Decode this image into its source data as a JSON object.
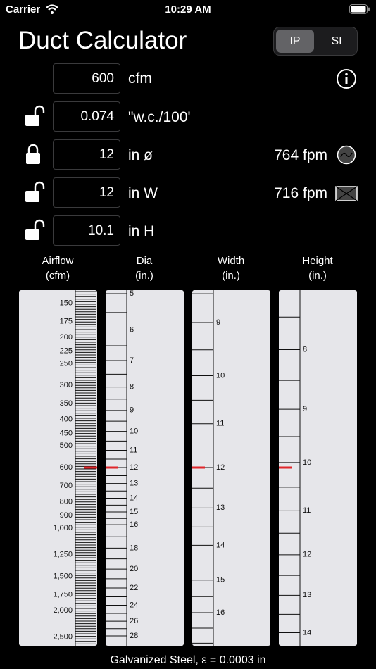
{
  "status": {
    "carrier": "Carrier",
    "time": "10:29 AM"
  },
  "title": "Duct Calculator",
  "units_toggle": {
    "options": [
      "IP",
      "SI"
    ],
    "selected": "IP"
  },
  "fields": [
    {
      "value": "600",
      "unit": "cfm",
      "locked": null
    },
    {
      "value": "0.074",
      "unit": "\"w.c./100'",
      "locked": false
    },
    {
      "value": "12",
      "unit": "in ø",
      "locked": true
    },
    {
      "value": "12",
      "unit": "in W",
      "locked": false
    },
    {
      "value": "10.1",
      "unit": "in H",
      "locked": false
    }
  ],
  "velocities": {
    "round": "764 fpm",
    "rect": "716 fpm"
  },
  "icons": {
    "info": "info-icon",
    "round": "round-duct-icon",
    "rect": "rect-duct-icon",
    "lock": "lock-icon",
    "unlock": "unlock-icon",
    "wifi": "wifi-icon",
    "battery": "battery-icon"
  },
  "columns": [
    {
      "line1": "Airflow",
      "line2": "(cfm)"
    },
    {
      "line1": "Dia",
      "line2": "(in.)"
    },
    {
      "line1": "Width",
      "line2": "(in.)"
    },
    {
      "line1": "Height",
      "line2": "(in.)"
    }
  ],
  "scales": {
    "airflow": {
      "labels": [
        "150",
        "175",
        "200",
        "225",
        "250",
        "300",
        "350",
        "400",
        "450",
        "500",
        "600",
        "700",
        "800",
        "900",
        "1,000",
        "1,250",
        "1,500",
        "1,750",
        "2,000",
        "2,500"
      ],
      "current": 600
    },
    "dia": {
      "labels": [
        "5",
        "6",
        "7",
        "8",
        "9",
        "10",
        "11",
        "12",
        "13",
        "14",
        "15",
        "16",
        "18",
        "20",
        "22",
        "24",
        "26",
        "28"
      ],
      "current": 12
    },
    "width": {
      "labels": [
        "9",
        "10",
        "11",
        "12",
        "13",
        "14",
        "15",
        "16"
      ],
      "current": 12
    },
    "height": {
      "labels": [
        "8",
        "9",
        "10",
        "11",
        "12",
        "13",
        "14"
      ],
      "current": 10.1
    }
  },
  "accent_color": "#e0262b",
  "footer": {
    "material": "Galvanized Steel, ε = 0.0003 in"
  }
}
